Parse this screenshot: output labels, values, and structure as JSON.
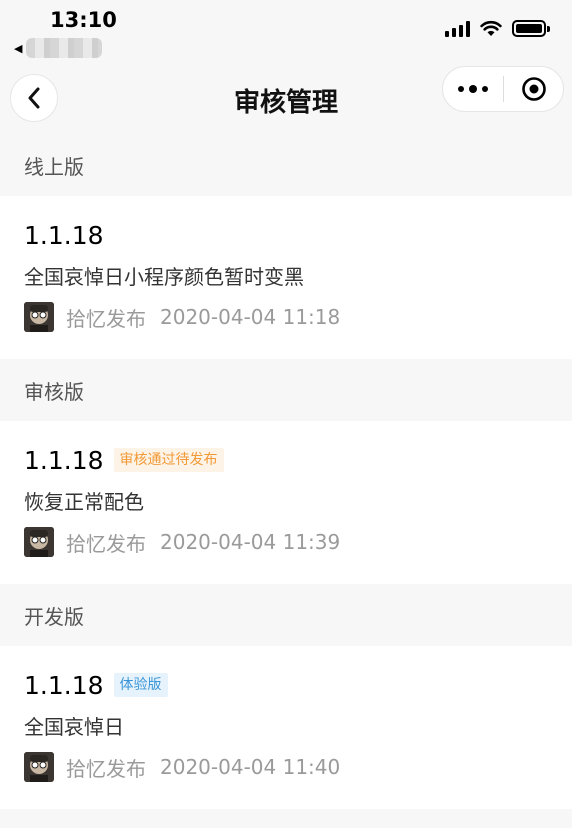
{
  "status_bar": {
    "time": "13:10"
  },
  "nav": {
    "title": "审核管理"
  },
  "sections": [
    {
      "header": "线上版",
      "version": "1.1.18",
      "badge": "",
      "description": "全国哀悼日小程序颜色暂时变黑",
      "publisher": "拾忆发布",
      "timestamp": "2020-04-04 11:18"
    },
    {
      "header": "审核版",
      "version": "1.1.18",
      "badge": "审核通过待发布",
      "description": "恢复正常配色",
      "publisher": "拾忆发布",
      "timestamp": "2020-04-04 11:39"
    },
    {
      "header": "开发版",
      "version": "1.1.18",
      "badge": "体验版",
      "description": "全国哀悼日",
      "publisher": "拾忆发布",
      "timestamp": "2020-04-04 11:40"
    }
  ],
  "colors": {
    "badge_pending_bg": "#fdf3e6",
    "badge_pending_text": "#f29a38",
    "badge_trial_bg": "#e7f3fc",
    "badge_trial_text": "#3a95d8"
  }
}
